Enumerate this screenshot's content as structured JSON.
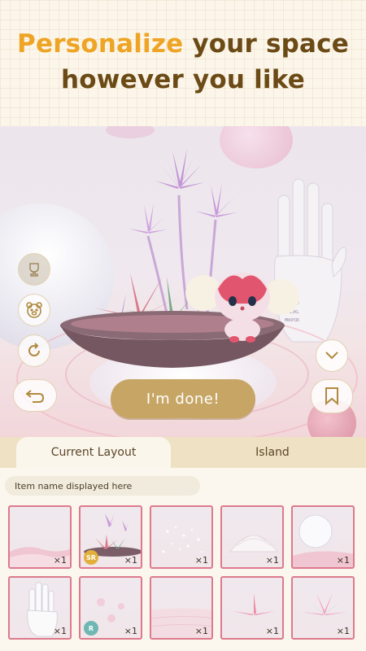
{
  "banner": {
    "headline_accent": "Personalize",
    "headline_rest_line1": " your space",
    "headline_line2": "however you like"
  },
  "controls": {
    "done_label": "I'm done!"
  },
  "tabs": [
    {
      "label": "Current Layout",
      "active": true
    },
    {
      "label": "Island",
      "active": false
    }
  ],
  "item_name_placeholder": "Item name displayed here",
  "items": [
    {
      "qty": "×1",
      "rarity": ""
    },
    {
      "qty": "×1",
      "rarity": "SR"
    },
    {
      "qty": "×1",
      "rarity": ""
    },
    {
      "qty": "×1",
      "rarity": ""
    },
    {
      "qty": "×1",
      "rarity": ""
    },
    {
      "qty": "×1",
      "rarity": ""
    },
    {
      "qty": "×1",
      "rarity": "R"
    },
    {
      "qty": "×1",
      "rarity": ""
    },
    {
      "qty": "×1",
      "rarity": ""
    },
    {
      "qty": "×1",
      "rarity": ""
    }
  ],
  "colors": {
    "accent_orange": "#eea424",
    "headline_brown": "#6b4a16",
    "done_button": "#c7a565",
    "item_border": "#dd7a8c",
    "rarity_sr": "#e2b03a",
    "rarity_r": "#6fb7b3"
  },
  "icons": [
    "trophy-icon",
    "bear-face-icon",
    "rotate-icon",
    "undo-arrow-icon",
    "chevron-down-icon",
    "bookmark-icon"
  ]
}
